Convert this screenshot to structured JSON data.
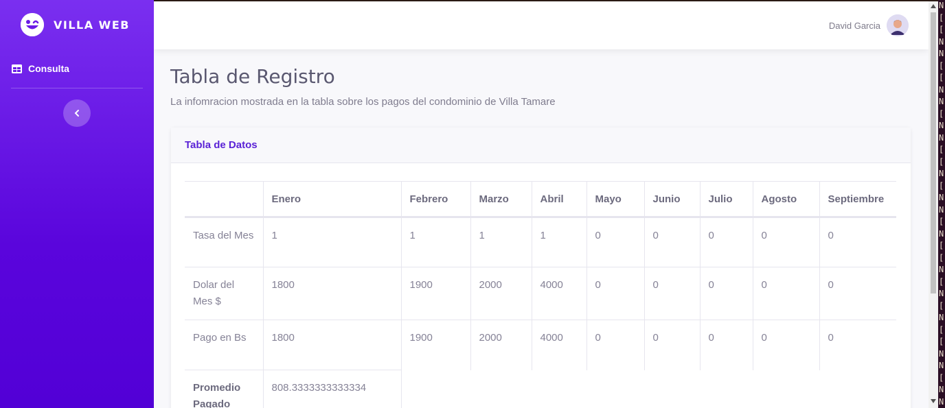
{
  "brand": {
    "name": "VILLA WEB"
  },
  "sidebar": {
    "items": [
      {
        "label": "Consulta",
        "icon": "table-icon"
      }
    ]
  },
  "user": {
    "name": "David Garcia"
  },
  "page": {
    "title": "Tabla de Registro",
    "subtitle": "La infomracion mostrada en la tabla sobre los pagos del condominio de Villa Tamare"
  },
  "card": {
    "title": "Tabla de Datos"
  },
  "table": {
    "columns": [
      "",
      "Enero",
      "Febrero",
      "Marzo",
      "Abril",
      "Mayo",
      "Junio",
      "Julio",
      "Agosto",
      "Septiembre"
    ],
    "rows": [
      {
        "label": "Tasa del Mes",
        "values": [
          "1",
          "1",
          "1",
          "1",
          "0",
          "0",
          "0",
          "0",
          "0"
        ]
      },
      {
        "label": "Dolar del Mes $",
        "values": [
          "1800",
          "1900",
          "2000",
          "4000",
          "0",
          "0",
          "0",
          "0",
          "0"
        ]
      },
      {
        "label": "Pago en Bs",
        "values": [
          "1800",
          "1900",
          "2000",
          "4000",
          "0",
          "0",
          "0",
          "0",
          "0"
        ]
      }
    ],
    "summary": {
      "label": "Promedio Pagado",
      "value": "808.3333333333334"
    }
  },
  "terminal_chars": [
    "N",
    "[",
    "[",
    "N",
    "N",
    "[",
    "[",
    "N",
    "N",
    "[",
    "N",
    "N",
    "[",
    "[",
    "N",
    "[",
    "N",
    "N",
    "[",
    "N",
    "[",
    "[",
    "N",
    "[",
    "N",
    "[",
    "N",
    "[",
    "[",
    "N",
    "N",
    "[",
    "N",
    "N"
  ],
  "colors": {
    "sidebar_top": "#7a2ff0",
    "sidebar_bottom": "#5200d6",
    "accent": "#5a22d6"
  }
}
